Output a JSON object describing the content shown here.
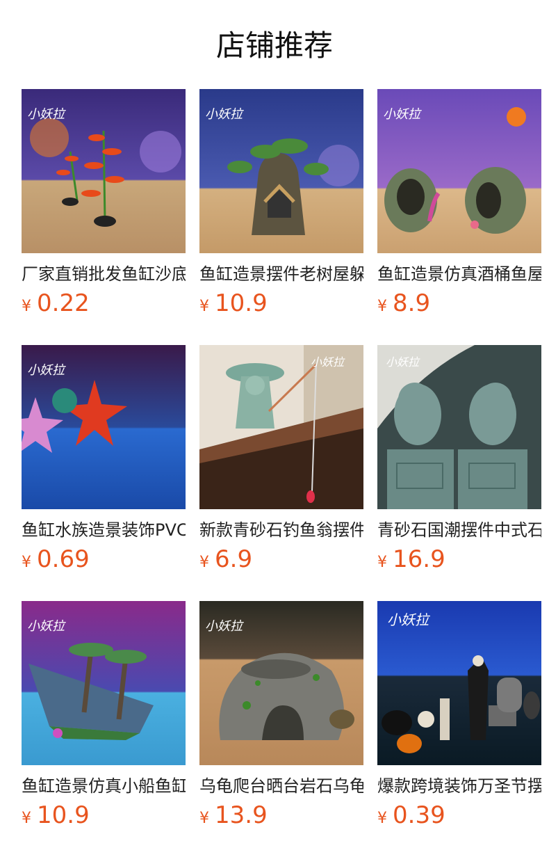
{
  "page": {
    "title": "店铺推荐"
  },
  "brand": {
    "logo_text": "小妖拉"
  },
  "colors": {
    "price": "#e8541e",
    "title": "#111111"
  },
  "products": [
    {
      "name": "厂家直销批发鱼缸沙底水草",
      "currency": "¥",
      "price": "0.22",
      "image": "red-water-plant"
    },
    {
      "name": "鱼缸造景摆件老树屋躲避屋",
      "currency": "¥",
      "price": "10.9",
      "image": "tree-house"
    },
    {
      "name": "鱼缸造景仿真酒桶鱼屋装饰",
      "currency": "¥",
      "price": "8.9",
      "image": "wine-barrel"
    },
    {
      "name": "鱼缸水族造景装饰PVC海星",
      "currency": "¥",
      "price": "0.69",
      "image": "starfish"
    },
    {
      "name": "新款青砂石钓鱼翁摆件装饰",
      "currency": "¥",
      "price": "6.9",
      "image": "fishing-old-man"
    },
    {
      "name": "青砂石国潮摆件中式石狮子",
      "currency": "¥",
      "price": "16.9",
      "image": "stone-lions"
    },
    {
      "name": "鱼缸造景仿真小船鱼缸装饰",
      "currency": "¥",
      "price": "10.9",
      "image": "shipwreck"
    },
    {
      "name": "乌龟爬台晒台岩石乌龟躲避",
      "currency": "¥",
      "price": "13.9",
      "image": "turtle-rock"
    },
    {
      "name": "爆款跨境装饰万圣节摆件",
      "currency": "¥",
      "price": "0.39",
      "image": "halloween-set"
    }
  ]
}
